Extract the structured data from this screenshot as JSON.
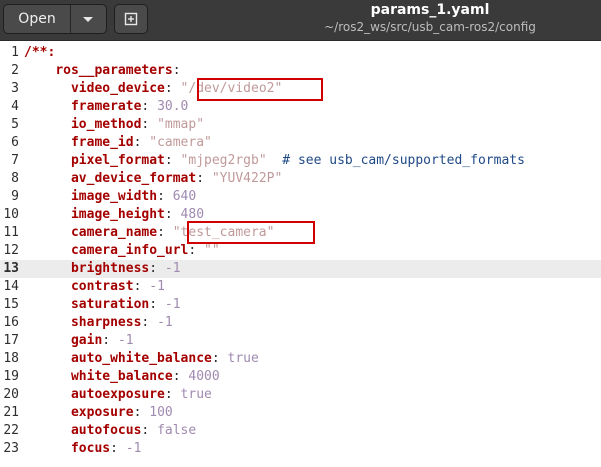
{
  "header": {
    "open_label": "Open",
    "title": "params_1.yaml",
    "subtitle": "~/ros2_ws/src/usb_cam-ros2/config",
    "icons": {
      "dropdown": "chevron-down-icon",
      "new_document": "new-document-icon"
    }
  },
  "editor": {
    "current_line": 13,
    "lines": [
      {
        "num": "1",
        "parts": [
          {
            "t": "/**:",
            "c": "k"
          }
        ]
      },
      {
        "num": "2",
        "parts": [
          {
            "t": "    ",
            "c": "p"
          },
          {
            "t": "ros__parameters",
            "c": "k"
          },
          {
            "t": ":",
            "c": "p"
          }
        ]
      },
      {
        "num": "3",
        "parts": [
          {
            "t": "      ",
            "c": "p"
          },
          {
            "t": "video_device",
            "c": "k"
          },
          {
            "t": ": ",
            "c": "p"
          },
          {
            "t": "\"/dev/video2\"",
            "c": "s"
          }
        ]
      },
      {
        "num": "4",
        "parts": [
          {
            "t": "      ",
            "c": "p"
          },
          {
            "t": "framerate",
            "c": "k"
          },
          {
            "t": ": ",
            "c": "p"
          },
          {
            "t": "30.0",
            "c": "n"
          }
        ]
      },
      {
        "num": "5",
        "parts": [
          {
            "t": "      ",
            "c": "p"
          },
          {
            "t": "io_method",
            "c": "k"
          },
          {
            "t": ": ",
            "c": "p"
          },
          {
            "t": "\"mmap\"",
            "c": "s"
          }
        ]
      },
      {
        "num": "6",
        "parts": [
          {
            "t": "      ",
            "c": "p"
          },
          {
            "t": "frame_id",
            "c": "k"
          },
          {
            "t": ": ",
            "c": "p"
          },
          {
            "t": "\"camera\"",
            "c": "s"
          }
        ]
      },
      {
        "num": "7",
        "parts": [
          {
            "t": "      ",
            "c": "p"
          },
          {
            "t": "pixel_format",
            "c": "k"
          },
          {
            "t": ": ",
            "c": "p"
          },
          {
            "t": "\"mjpeg2rgb\"",
            "c": "s"
          },
          {
            "t": "  ",
            "c": "p"
          },
          {
            "t": "# see usb_cam/supported_formats",
            "c": "c"
          }
        ]
      },
      {
        "num": "8",
        "parts": [
          {
            "t": "      ",
            "c": "p"
          },
          {
            "t": "av_device_format",
            "c": "k"
          },
          {
            "t": ": ",
            "c": "p"
          },
          {
            "t": "\"YUV422P\"",
            "c": "s"
          }
        ]
      },
      {
        "num": "9",
        "parts": [
          {
            "t": "      ",
            "c": "p"
          },
          {
            "t": "image_width",
            "c": "k"
          },
          {
            "t": ": ",
            "c": "p"
          },
          {
            "t": "640",
            "c": "n"
          }
        ]
      },
      {
        "num": "10",
        "parts": [
          {
            "t": "      ",
            "c": "p"
          },
          {
            "t": "image_height",
            "c": "k"
          },
          {
            "t": ": ",
            "c": "p"
          },
          {
            "t": "480",
            "c": "n"
          }
        ]
      },
      {
        "num": "11",
        "parts": [
          {
            "t": "      ",
            "c": "p"
          },
          {
            "t": "camera_name",
            "c": "k"
          },
          {
            "t": ": ",
            "c": "p"
          },
          {
            "t": "\"test_camera\"",
            "c": "s"
          }
        ]
      },
      {
        "num": "12",
        "parts": [
          {
            "t": "      ",
            "c": "p"
          },
          {
            "t": "camera_info_url",
            "c": "k"
          },
          {
            "t": ": ",
            "c": "p"
          },
          {
            "t": "\"\"",
            "c": "s"
          }
        ]
      },
      {
        "num": "13",
        "parts": [
          {
            "t": "      ",
            "c": "p"
          },
          {
            "t": "brightness",
            "c": "k"
          },
          {
            "t": ": ",
            "c": "p"
          },
          {
            "t": "-1",
            "c": "n"
          }
        ]
      },
      {
        "num": "14",
        "parts": [
          {
            "t": "      ",
            "c": "p"
          },
          {
            "t": "contrast",
            "c": "k"
          },
          {
            "t": ": ",
            "c": "p"
          },
          {
            "t": "-1",
            "c": "n"
          }
        ]
      },
      {
        "num": "15",
        "parts": [
          {
            "t": "      ",
            "c": "p"
          },
          {
            "t": "saturation",
            "c": "k"
          },
          {
            "t": ": ",
            "c": "p"
          },
          {
            "t": "-1",
            "c": "n"
          }
        ]
      },
      {
        "num": "16",
        "parts": [
          {
            "t": "      ",
            "c": "p"
          },
          {
            "t": "sharpness",
            "c": "k"
          },
          {
            "t": ": ",
            "c": "p"
          },
          {
            "t": "-1",
            "c": "n"
          }
        ]
      },
      {
        "num": "17",
        "parts": [
          {
            "t": "      ",
            "c": "p"
          },
          {
            "t": "gain",
            "c": "k"
          },
          {
            "t": ": ",
            "c": "p"
          },
          {
            "t": "-1",
            "c": "n"
          }
        ]
      },
      {
        "num": "18",
        "parts": [
          {
            "t": "      ",
            "c": "p"
          },
          {
            "t": "auto_white_balance",
            "c": "k"
          },
          {
            "t": ": ",
            "c": "p"
          },
          {
            "t": "true",
            "c": "n"
          }
        ]
      },
      {
        "num": "19",
        "parts": [
          {
            "t": "      ",
            "c": "p"
          },
          {
            "t": "white_balance",
            "c": "k"
          },
          {
            "t": ": ",
            "c": "p"
          },
          {
            "t": "4000",
            "c": "n"
          }
        ]
      },
      {
        "num": "20",
        "parts": [
          {
            "t": "      ",
            "c": "p"
          },
          {
            "t": "autoexposure",
            "c": "k"
          },
          {
            "t": ": ",
            "c": "p"
          },
          {
            "t": "true",
            "c": "n"
          }
        ]
      },
      {
        "num": "21",
        "parts": [
          {
            "t": "      ",
            "c": "p"
          },
          {
            "t": "exposure",
            "c": "k"
          },
          {
            "t": ": ",
            "c": "p"
          },
          {
            "t": "100",
            "c": "n"
          }
        ]
      },
      {
        "num": "22",
        "parts": [
          {
            "t": "      ",
            "c": "p"
          },
          {
            "t": "autofocus",
            "c": "k"
          },
          {
            "t": ": ",
            "c": "p"
          },
          {
            "t": "false",
            "c": "n"
          }
        ]
      },
      {
        "num": "23",
        "parts": [
          {
            "t": "      ",
            "c": "p"
          },
          {
            "t": "focus",
            "c": "k"
          },
          {
            "t": ": ",
            "c": "p"
          },
          {
            "t": "-1",
            "c": "n"
          }
        ]
      }
    ]
  },
  "colors": {
    "key": "#a40000",
    "string": "#c09a9a",
    "number": "#a08ab0",
    "comment": "#204a87",
    "highlight_box": "#d00000",
    "header_bg": "#3a3a3a",
    "current_line_bg": "#ececec"
  }
}
